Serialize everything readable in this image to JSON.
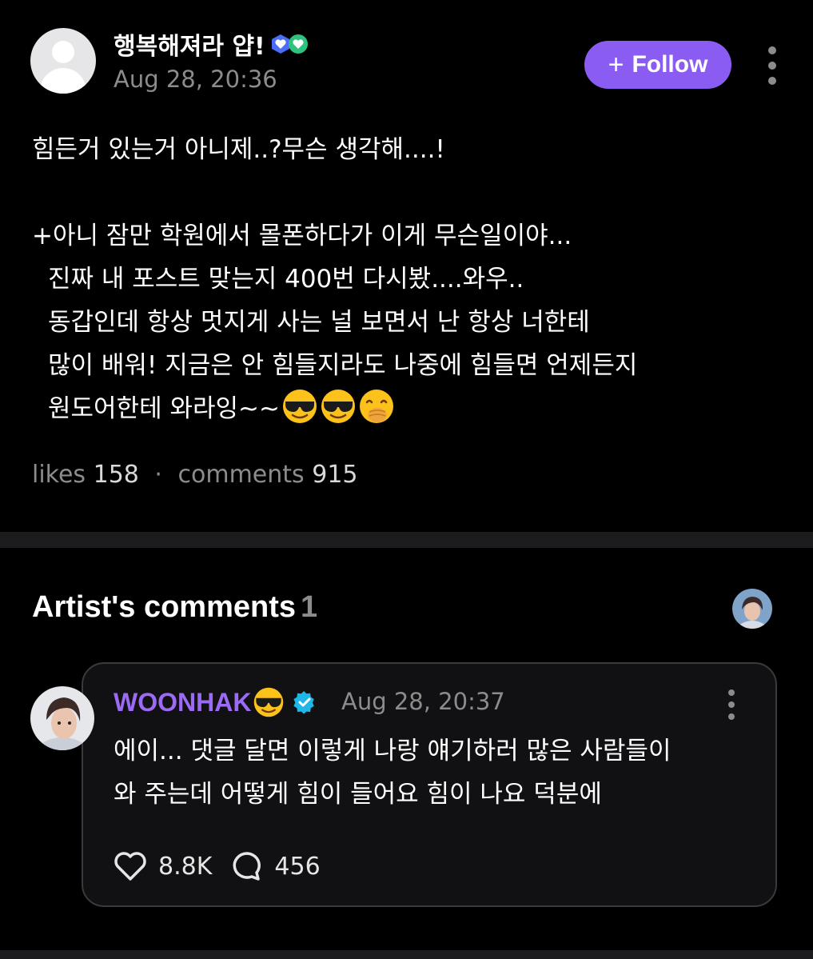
{
  "post": {
    "username": "행복해져라 얍!",
    "date": "Aug 28, 20:36",
    "follow_label": "Follow",
    "follow_icon": "plus-icon",
    "lines": [
      "힘든거 있는거 아니제..?무슨 생각해....!",
      "+아니 잠만 학원에서 몰폰하다가 이게 무슨일이야...",
      "진짜 내 포스트 맞는지 400번 다시봤....와우..",
      "동갑인데 항상 멋지게 사는 널 보면서 난 항상 너한테",
      "많이 배워! 지금은 안 힘들지라도 나중에 힘들면 언제든지",
      "원도어한테 와라잉~~"
    ],
    "trailing_emojis": [
      "smiling-face-with-sunglasses",
      "smiling-face-with-sunglasses",
      "face-with-hand-over-mouth"
    ],
    "badge_icons": [
      "blue-heart-badge-icon",
      "green-heart-badge-icon"
    ],
    "stats": {
      "likes_label": "likes",
      "likes": "158",
      "separator": "·",
      "comments_label": "comments",
      "comments": "915"
    }
  },
  "artist_comments": {
    "title": "Artist's comments",
    "count": "1",
    "comment": {
      "name": "WOONHAK",
      "name_emoji": "smiling-face-with-sunglasses",
      "verified_icon": "verified-badge-icon",
      "date": "Aug 28, 20:37",
      "lines": [
        "에이... 댓글 달면 이렇게 나랑 얘기하러 많은 사람들이",
        "와 주는데 어떻게 힘이 들어요 힘이 나요 덕분에"
      ],
      "likes": "8.8K",
      "replies": "456"
    }
  },
  "colors": {
    "background": "#000000",
    "accent": "#8a5cf2",
    "artist_name": "#9b6bf5",
    "muted": "#8c8c8c",
    "verified": "#1fb6e8"
  }
}
